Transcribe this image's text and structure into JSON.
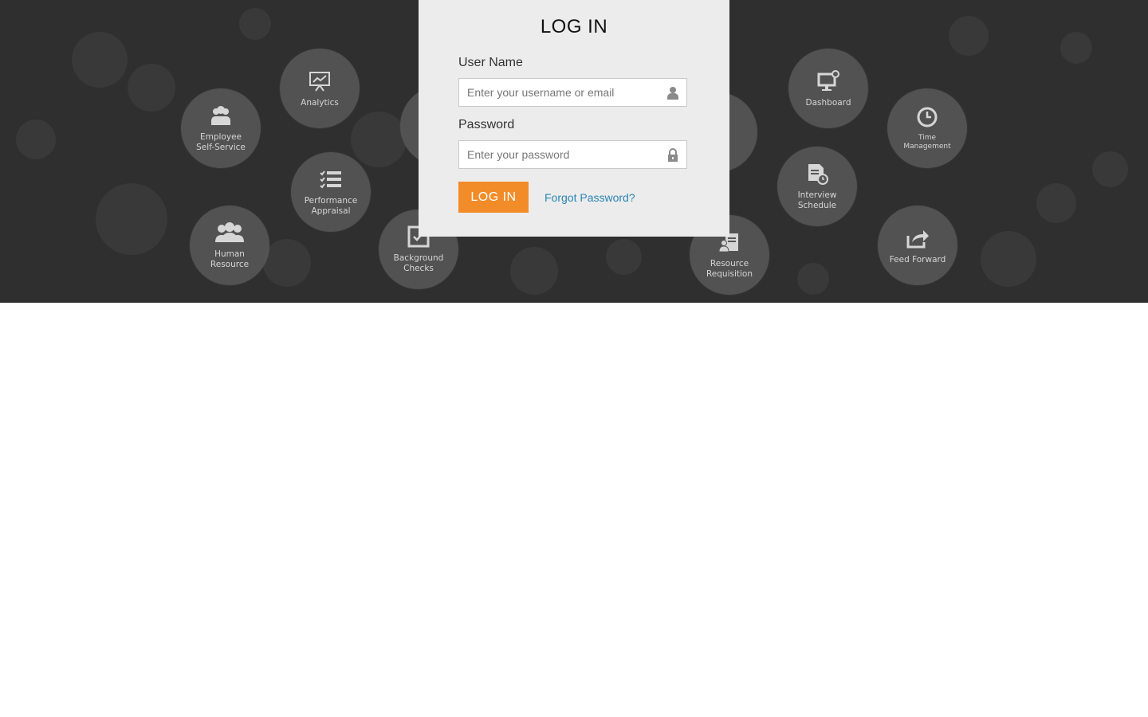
{
  "login": {
    "title": "LOG IN",
    "username_label": "User Name",
    "username_placeholder": "Enter your username or email",
    "password_label": "Password",
    "password_placeholder": "Enter your password",
    "login_button": "LOG IN",
    "forgot_link": "Forgot Password?"
  },
  "modules": {
    "analytics": "Analytics",
    "employee_self_service": "Employee\nSelf-Service",
    "performance_appraisal": "Performance\nAppraisal",
    "human_resource": "Human\nResource",
    "background_checks": "Background\nChecks",
    "dashboard": "Dashboard",
    "time_management": "Time\nManagement",
    "interview_schedule": "Interview\nSchedule",
    "resource_requisition": "Resource\nRequisition",
    "feed_forward": "Feed Forward"
  },
  "colors": {
    "hero_background": "#2f2f2f",
    "panel_background": "#ececec",
    "accent": "#f28c28",
    "link": "#2a84b3"
  },
  "icons": {
    "username_field": "user-icon",
    "password_field": "lock-icon"
  }
}
